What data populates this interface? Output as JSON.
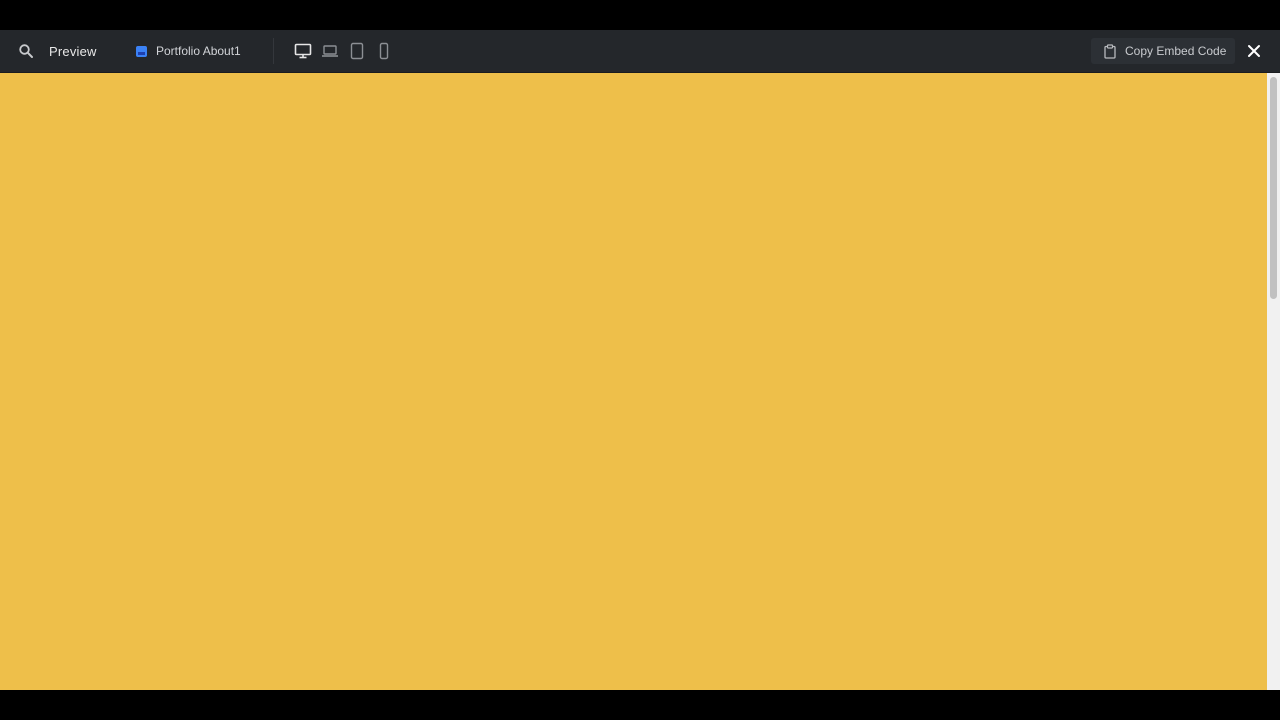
{
  "toolbar": {
    "preview_label": "Preview",
    "page_tab_label": "Portfolio About1",
    "devices": [
      {
        "icon": "desktop-icon",
        "active": true
      },
      {
        "icon": "laptop-icon",
        "active": false
      },
      {
        "icon": "tablet-icon",
        "active": false
      },
      {
        "icon": "mobile-icon",
        "active": false
      }
    ],
    "embed_label": "Copy Embed Code"
  },
  "colors": {
    "toolbar_bg": "#24272b",
    "canvas_bg": "#eebf4a",
    "accent": "#3b82f6"
  }
}
